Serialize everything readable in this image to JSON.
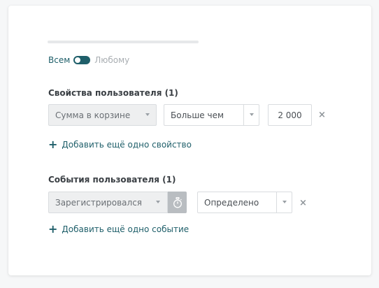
{
  "toggle": {
    "left_label": "Всем",
    "right_label": "Любому",
    "state": "left"
  },
  "user_properties": {
    "title": "Свойства пользователя (1)",
    "property_select": "Сумма в корзине",
    "operator_select": "Больше чем",
    "value": "2 000",
    "remove_glyph": "×",
    "add_label": "Добавить ещё одно свойство"
  },
  "user_events": {
    "title": "События пользователя (1)",
    "event_select": "Зарегистрировался",
    "operator_select": "Определено",
    "remove_glyph": "×",
    "add_label": "Добавить ещё одно событие"
  },
  "icons": {
    "plus": "+",
    "timer": "stopwatch-icon",
    "caret": "caret-down-icon"
  },
  "colors": {
    "accent": "#1f5f6a",
    "muted": "#a9aeb2",
    "field_grey": "#eeeff0"
  }
}
